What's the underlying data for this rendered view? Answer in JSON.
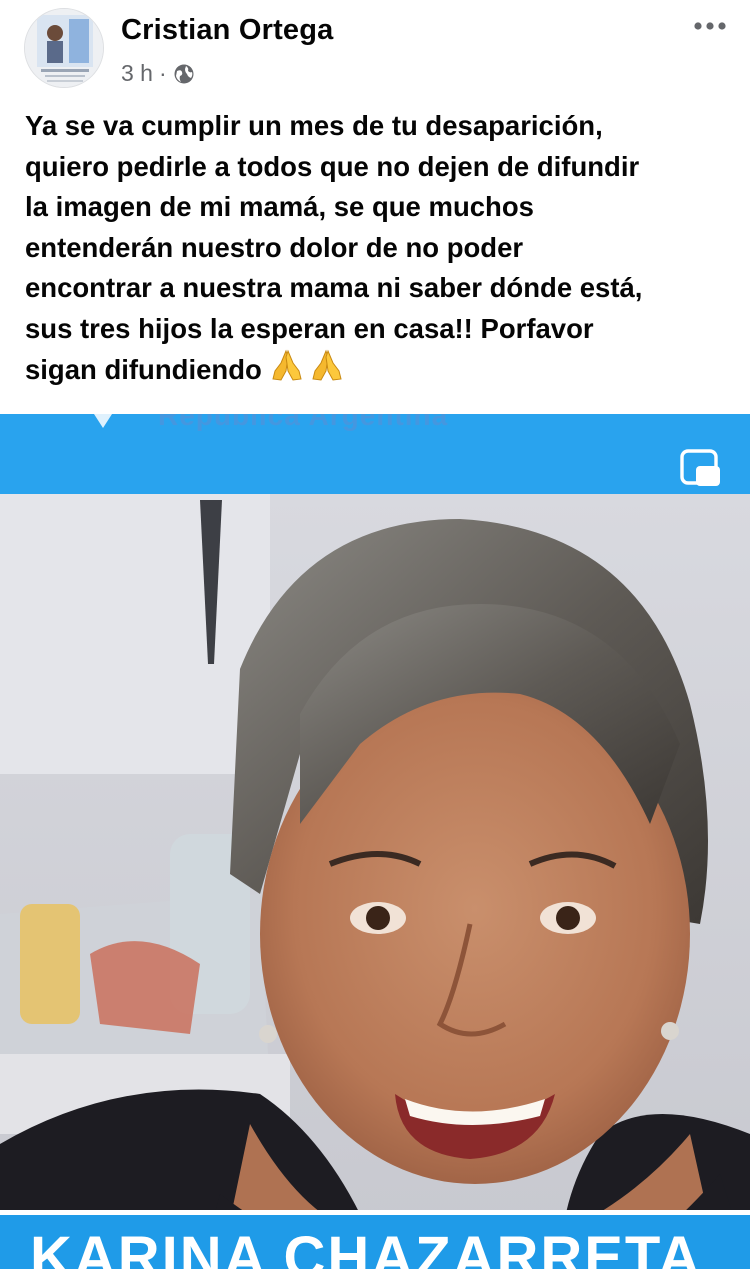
{
  "post": {
    "author": "Cristian Ortega",
    "time": "3 h",
    "separator": "·",
    "privacy_icon": "globe-icon",
    "more_icon": "more-options-icon",
    "text_lines": [
      "Ya se va cumplir un mes de tu desaparición,",
      "quiero pedirle a todos que no dejen de difundir",
      "la imagen de mi mamá, se que muchos",
      "entenderán nuestro dolor de no poder",
      "encontrar a nuestra mama ni saber dónde está,",
      "sus tres hijos la esperan en casa!! Porfavor",
      "sigan difundiendo"
    ],
    "emoji": "🙏🙏"
  },
  "media": {
    "banner_text": "República Argentina",
    "pip_icon": "picture-in-picture-icon",
    "name_caption": "KARINA CHAZARRETA"
  },
  "colors": {
    "banner_blue": "#29a3ee",
    "caption_blue": "#1f9be8",
    "meta_gray": "#65676b",
    "text_black": "#050505"
  }
}
